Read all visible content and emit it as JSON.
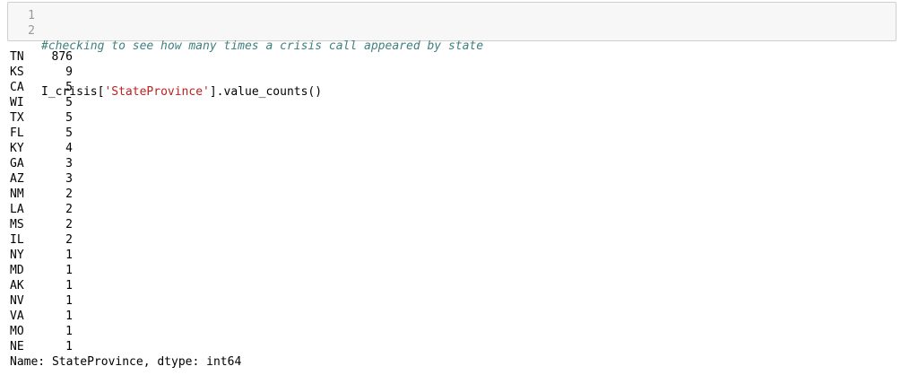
{
  "input": {
    "line_numbers": [
      "1",
      "2"
    ],
    "comment": "#checking to see how many times a crisis call appeared by state",
    "code_prefix": "I_crisis[",
    "code_string": "'StateProvince'",
    "code_suffix": "].value_counts()"
  },
  "output": {
    "rows": [
      {
        "state": "TN",
        "count": "876"
      },
      {
        "state": "KS",
        "count": "9"
      },
      {
        "state": "CA",
        "count": "5"
      },
      {
        "state": "WI",
        "count": "5"
      },
      {
        "state": "TX",
        "count": "5"
      },
      {
        "state": "FL",
        "count": "5"
      },
      {
        "state": "KY",
        "count": "4"
      },
      {
        "state": "GA",
        "count": "3"
      },
      {
        "state": "AZ",
        "count": "3"
      },
      {
        "state": "NM",
        "count": "2"
      },
      {
        "state": "LA",
        "count": "2"
      },
      {
        "state": "MS",
        "count": "2"
      },
      {
        "state": "IL",
        "count": "2"
      },
      {
        "state": "NY",
        "count": "1"
      },
      {
        "state": "MD",
        "count": "1"
      },
      {
        "state": "AK",
        "count": "1"
      },
      {
        "state": "NV",
        "count": "1"
      },
      {
        "state": "VA",
        "count": "1"
      },
      {
        "state": "MO",
        "count": "1"
      },
      {
        "state": "NE",
        "count": "1"
      }
    ],
    "footer": "Name: StateProvince, dtype: int64"
  },
  "colors": {
    "cell_background": "#f7f7f7",
    "cell_border": "#cfcfcf",
    "comment": "#408080",
    "string": "#ba2121",
    "line_number": "#999999"
  }
}
